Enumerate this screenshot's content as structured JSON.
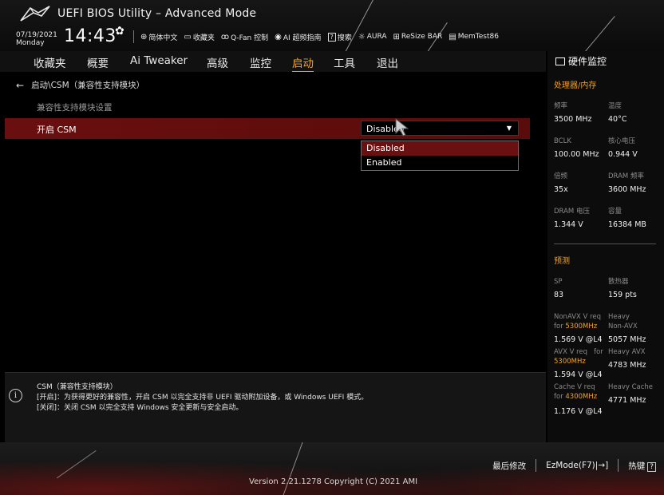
{
  "header": {
    "title": "UEFI BIOS Utility – Advanced Mode",
    "date": "07/19/2021",
    "weekday": "Monday",
    "time": "14:43",
    "toolbar": [
      {
        "icon": "globe-icon",
        "glyph": "⊕",
        "label": "简体中文"
      },
      {
        "icon": "favorites-icon",
        "glyph": "▭",
        "label": "收藏夹"
      },
      {
        "icon": "fan-icon",
        "glyph": "ꝏ",
        "label": "Q-Fan 控制"
      },
      {
        "icon": "ai-icon",
        "glyph": "◉",
        "label": "AI 超频指南"
      },
      {
        "icon": "search-icon",
        "glyph": "?",
        "label": "搜索"
      },
      {
        "icon": "aura-icon",
        "glyph": "☼",
        "label": "AURA"
      },
      {
        "icon": "resize-bar-icon",
        "glyph": "⊞",
        "label": "ReSize BAR"
      },
      {
        "icon": "memtest-icon",
        "glyph": "▤",
        "label": "MemTest86"
      }
    ]
  },
  "menu": {
    "tabs": [
      "收藏夹",
      "概要",
      "Ai Tweaker",
      "高级",
      "监控",
      "启动",
      "工具",
      "退出"
    ],
    "active": "启动"
  },
  "main": {
    "breadcrumb": "启动\\CSM（兼容性支持模块）",
    "section_title": "兼容性支持模块设置",
    "csm_label": "开启 CSM",
    "csm_value": "Disabled",
    "options": [
      "Disabled",
      "Enabled"
    ]
  },
  "help": {
    "line1": "CSM（兼容性支持模块）",
    "line2": "[开启]：为获得更好的兼容性，开启 CSM 以完全支持非 UEFI 驱动附加设备，或 Windows UEFI 模式。",
    "line3": "[关闭]：关闭 CSM 以完全支持 Windows 安全更新与安全启动。"
  },
  "hw": {
    "title": "硬件监控",
    "cpu_mem": "处理器/内存",
    "freq_label": "频率",
    "freq": "3500 MHz",
    "temp_label": "温度",
    "temp": "40°C",
    "bclk_label": "BCLK",
    "bclk": "100.00 MHz",
    "vcore_label": "核心电压",
    "vcore": "0.944 V",
    "ratio_label": "倍频",
    "ratio": "35x",
    "dram_freq_label": "DRAM 频率",
    "dram_freq": "3600 MHz",
    "dram_volt_label": "DRAM 电压",
    "dram_volt": "1.344 V",
    "capacity_label": "容量",
    "capacity": "16384 MB",
    "predict": "预测",
    "sp_label": "SP",
    "sp": "83",
    "cooler_label": "散热器",
    "cooler": "159 pts",
    "nonavx_req": "NonAVX V req",
    "nonavx_for": "for",
    "nonavx_freq": "5300MHz",
    "nonavx_volt": "1.569 V @L4",
    "heavy_nonavx_1": "Heavy",
    "heavy_nonavx_2": "Non-AVX",
    "heavy_nonavx_val": "5057 MHz",
    "avx_req": "AVX V req",
    "avx_for": "for",
    "avx_freq": "5300MHz",
    "avx_volt": "1.594 V @L4",
    "heavy_avx": "Heavy AVX",
    "heavy_avx_val": "4783 MHz",
    "cache_req": "Cache V req",
    "cache_for": "for",
    "cache_freq": "4300MHz",
    "cache_volt": "1.176 V @L4",
    "heavy_cache": "Heavy Cache",
    "heavy_cache_val": "4771 MHz"
  },
  "footer": {
    "version": "Version 2.21.1278 Copyright (C) 2021 AMI",
    "last_modified": "最后修改",
    "ezmode": "EzMode(F7)",
    "ezmode_glyph": "|→]",
    "hotkeys": "热键",
    "hotkeys_glyph": "?"
  },
  "colors": {
    "accent": "#f4a321",
    "highlight_red": "#6a0f0f"
  }
}
